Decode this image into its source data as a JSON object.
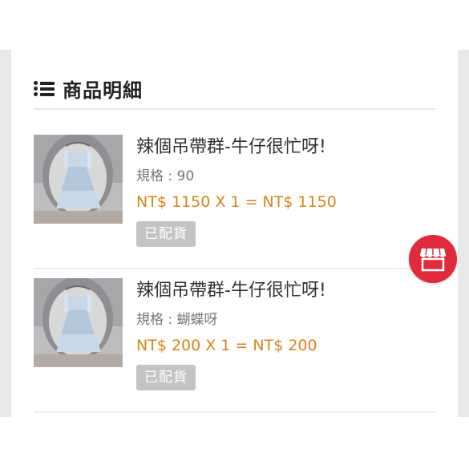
{
  "section": {
    "title": "商品明細",
    "icon": "list-icon"
  },
  "items": [
    {
      "name": "辣個吊帶群-牛仔很忙呀!",
      "spec": "規格 : 90",
      "price": "NT$ 1150 X 1 = NT$ 1150",
      "status": "已配貨",
      "image": "denim-dress-photo"
    },
    {
      "name": "辣個吊帶群-牛仔很忙呀!",
      "spec": "規格 : 蝴蝶呀",
      "price": "NT$ 200 X 1 = NT$ 200",
      "status": "已配貨",
      "image": "denim-dress-photo"
    }
  ],
  "floating_button": {
    "icon": "store-icon",
    "color": "#e02b3c"
  },
  "colors": {
    "price": "#d9831c",
    "badge": "#c4c4c4"
  }
}
